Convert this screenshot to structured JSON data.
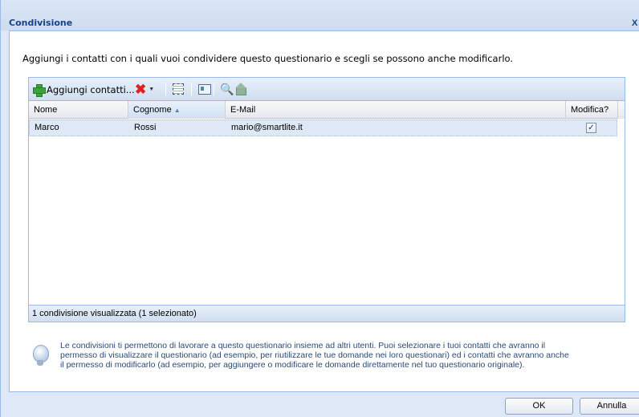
{
  "window": {
    "title": "Condivisione",
    "close_symbol": "X"
  },
  "intro_text": "Aggiungi i contatti con i quali vuoi condividere questo questionario e scegli se possono anche modificarlo.",
  "toolbar": {
    "add_label": "Aggiungi contatti...",
    "add_icon": "green-plus-icon",
    "delete_icon": "red-x-icon",
    "delete_symbol": "✖",
    "dropdown_symbol": "▼",
    "binoculars_symbol": "🔍"
  },
  "grid": {
    "columns": [
      {
        "label": "Nome"
      },
      {
        "label": "Cognome",
        "sorted": "ascending",
        "sort_symbol": "▲"
      },
      {
        "label": "E-Mail"
      },
      {
        "label": "Modifica?"
      }
    ],
    "rows": [
      {
        "nome": "Marco",
        "cognome": "Rossi",
        "email": "mario@smartlite.it",
        "modifica": true,
        "check_symbol": "✓",
        "selected": true
      }
    ],
    "status": "1 condivisione visualizzata (1 selezionato)"
  },
  "help": {
    "icon": "lightbulb-icon",
    "lines": [
      "Le condivisioni ti permettono di lavorare a questo questionario insieme ad altri utenti. Puoi selezionare i tuoi contatti che avranno il",
      "permesso di visualizzare il questionario (ad esempio, per riutilizzare le tue domande nei loro questionari) ed i contatti che avranno anche",
      "il permesso di modificarlo (ad esempio, per aggiungere o modificare le domande direttamente nel tuo questionario originale)."
    ]
  },
  "buttons": {
    "ok": "OK",
    "cancel": "Annulla"
  },
  "colors": {
    "title": "#15428b",
    "frame": "#dfe8f6",
    "border": "#99bbe8",
    "selected_row": "#dfe8f6",
    "help_text": "#2b4a75"
  }
}
